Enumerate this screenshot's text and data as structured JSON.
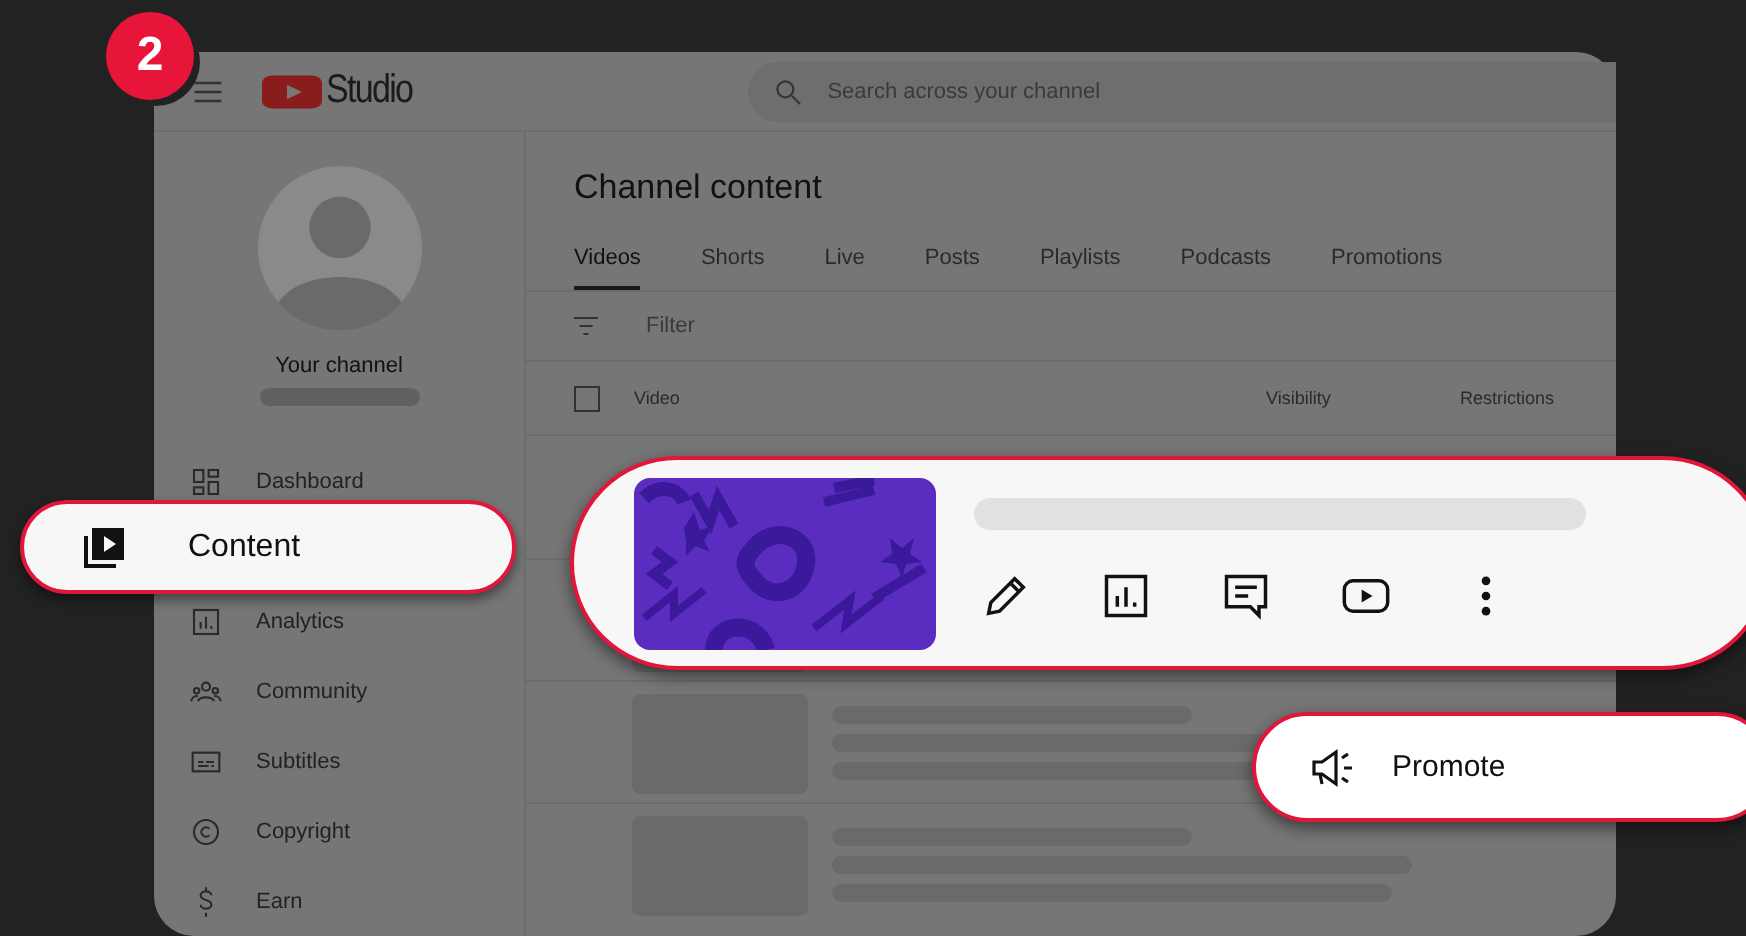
{
  "step_badge": "2",
  "header": {
    "logo_text": "Studio",
    "search": {
      "placeholder": "Search across your channel"
    }
  },
  "sidebar": {
    "channel_label": "Your channel",
    "items": [
      {
        "label": "Dashboard",
        "kind": "dashboard",
        "highlighted": false
      },
      {
        "label": "Content",
        "kind": "content",
        "highlighted": true
      },
      {
        "label": "Analytics",
        "kind": "analytics",
        "highlighted": false
      },
      {
        "label": "Community",
        "kind": "community",
        "highlighted": false
      },
      {
        "label": "Subtitles",
        "kind": "subtitles",
        "highlighted": false
      },
      {
        "label": "Copyright",
        "kind": "copyright",
        "highlighted": false
      },
      {
        "label": "Earn",
        "kind": "earn",
        "highlighted": false
      }
    ]
  },
  "main": {
    "title": "Channel content",
    "tabs": [
      {
        "label": "Videos",
        "selected": true
      },
      {
        "label": "Shorts",
        "selected": false
      },
      {
        "label": "Live",
        "selected": false
      },
      {
        "label": "Posts",
        "selected": false
      },
      {
        "label": "Playlists",
        "selected": false
      },
      {
        "label": "Podcasts",
        "selected": false
      },
      {
        "label": "Promotions",
        "selected": false
      }
    ],
    "filter": {
      "placeholder": "Filter"
    },
    "select_all": {
      "checked": false
    },
    "columns": [
      "Video",
      "Visibility",
      "Restrictions"
    ]
  },
  "video_callout": {
    "actions": [
      {
        "kind": "edit"
      },
      {
        "kind": "analytics"
      },
      {
        "kind": "comments"
      },
      {
        "kind": "play"
      },
      {
        "kind": "more"
      }
    ]
  },
  "menu_callout": {
    "label": "Promote",
    "kind": "megaphone"
  }
}
